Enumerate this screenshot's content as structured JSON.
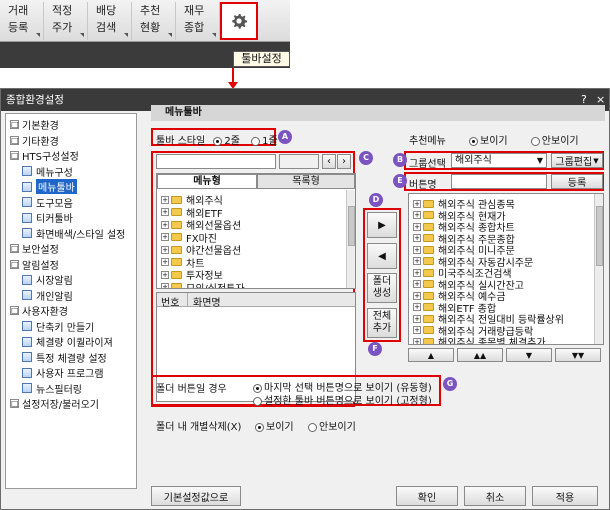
{
  "toolbar": {
    "buttons": [
      {
        "line1": "거래",
        "line2": "등록"
      },
      {
        "line1": "적정",
        "line2": "주가"
      },
      {
        "line1": "배당",
        "line2": "검색"
      },
      {
        "line1": "추천",
        "line2": "현황"
      },
      {
        "line1": "재무",
        "line2": "종합"
      }
    ],
    "tooltip": "툴바설정"
  },
  "dialog": {
    "title": "종합환경설정",
    "help": "?",
    "close": "×"
  },
  "tree": {
    "items": [
      {
        "label": "기본환경",
        "type": "group"
      },
      {
        "label": "기타환경",
        "type": "group"
      },
      {
        "label": "HTS구성설정",
        "type": "group"
      },
      {
        "label": "메뉴구성",
        "type": "page"
      },
      {
        "label": "메뉴툴바",
        "type": "page",
        "selected": true
      },
      {
        "label": "도구모음",
        "type": "page"
      },
      {
        "label": "티커툴바",
        "type": "page"
      },
      {
        "label": "화면배색/스타일 설정",
        "type": "page"
      },
      {
        "label": "보안설정",
        "type": "group"
      },
      {
        "label": "알림설정",
        "type": "group"
      },
      {
        "label": "시장알림",
        "type": "page"
      },
      {
        "label": "개인알림",
        "type": "page"
      },
      {
        "label": "사용자환경",
        "type": "group"
      },
      {
        "label": "단축키 만들기",
        "type": "page"
      },
      {
        "label": "체결량 이퀄라이져",
        "type": "page"
      },
      {
        "label": "특정 체결량 설정",
        "type": "page"
      },
      {
        "label": "사용자 프로그램",
        "type": "page"
      },
      {
        "label": "뉴스필터링",
        "type": "page"
      },
      {
        "label": "설정저장/불러오기",
        "type": "group"
      }
    ]
  },
  "panel": {
    "title": "메뉴툴바"
  },
  "style_row": {
    "label": "툴바 스타일",
    "opt1": "2줄",
    "opt2": "1줄",
    "badge": "A"
  },
  "recommend": {
    "label": "추천메뉴",
    "opt1": "보이기",
    "opt2": "안보이기"
  },
  "left": {
    "badge": "C",
    "tab1": "메뉴형",
    "tab2": "목록형",
    "items": [
      "해외주식",
      "해외ETF",
      "해외선물옵션",
      "FX마진",
      "야간선물옵션",
      "차트",
      "투자정보",
      "모의/실전투자"
    ],
    "col_no": "번호",
    "col_name": "화면명"
  },
  "group": {
    "badge": "B",
    "label": "그룹선택",
    "value": "해외주식",
    "edit": "그룹편집"
  },
  "btnname": {
    "badge": "E",
    "label": "버튼명",
    "register": "등록"
  },
  "move": {
    "badge_d": "D",
    "badge_f": "F",
    "right": "▶",
    "left": "◀",
    "gen1": "폴더",
    "gen2": "생성",
    "all1": "전체",
    "all2": "추가"
  },
  "right": {
    "items": [
      "해외주식 관심종목",
      "해외주식 현재가",
      "해외주식 종합차트",
      "해외주식 주문종합",
      "해외주식 미니주문",
      "해외주식 자동감시주문",
      "미국주식조건검색",
      "해외주식 실시간잔고",
      "해외주식 예수금",
      "해외ETF 종합",
      "해외주식 전일대비 등락률상위",
      "해외주식 거래량급등락",
      "해외주식 종목별 체결추가"
    ],
    "nav": [
      "▲",
      "▲▲",
      "▼",
      "▼▼"
    ]
  },
  "folder_btn": {
    "badge": "G",
    "label": "폴더 버튼일 경우",
    "opt1": "마지막 선택 버튼명으로 보이기 (유동형)",
    "opt2": "설정한 툴바 버튼명으로 보이기 (고정형)"
  },
  "delete_row": {
    "label": "폴더 내 개별삭제(X)",
    "opt1": "보이기",
    "opt2": "안보이기"
  },
  "footer": {
    "reset": "기본설정값으로",
    "ok": "확인",
    "cancel": "취소",
    "apply": "적용"
  },
  "colors": {
    "annotation": "#e00000",
    "badge": "#7a54c0",
    "selected": "#1e66c8"
  }
}
